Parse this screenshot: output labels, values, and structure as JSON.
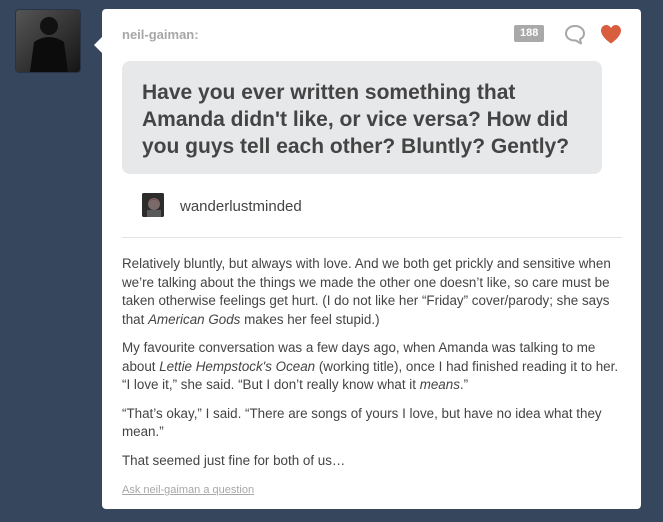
{
  "post": {
    "username": "neil-gaiman:",
    "notes_count": "188",
    "question": "Have you ever written something that Amanda didn't like, or vice versa? How did you guys tell each other? Bluntly? Gently?",
    "asker": "wanderlustminded",
    "answer": {
      "p1": {
        "a": "Relatively bluntly, but always with love. And we both get prickly and sensitive when we’re talking about the things we made the other one doesn’t like, so care must be taken otherwise feelings get hurt. (I do not like her “Friday” cover/parody; she says that ",
        "em": "American Gods",
        "b": " makes her feel stupid.)"
      },
      "p2": {
        "a": "My favourite conversation was a few days ago, when Amanda was talking to me about ",
        "em1": "Lettie Hempstock's Ocean",
        "b": " (working title), once I had finished reading it to her. “I love it,” she said. “But I don’t really know what it ",
        "em2": "means",
        "c": ".”"
      },
      "p3": "“That’s okay,” I said. “There are songs of yours I love, but have no idea what they mean.”",
      "p4": "That seemed just fine for both of us…"
    },
    "ask_link": "Ask neil-gaiman a question"
  },
  "icons": {
    "reply": "speech-bubble-icon",
    "like": "heart-icon"
  },
  "colors": {
    "background": "#36465d",
    "heart": "#d95e40",
    "question_box": "#e7e8ea",
    "text": "#444444"
  }
}
